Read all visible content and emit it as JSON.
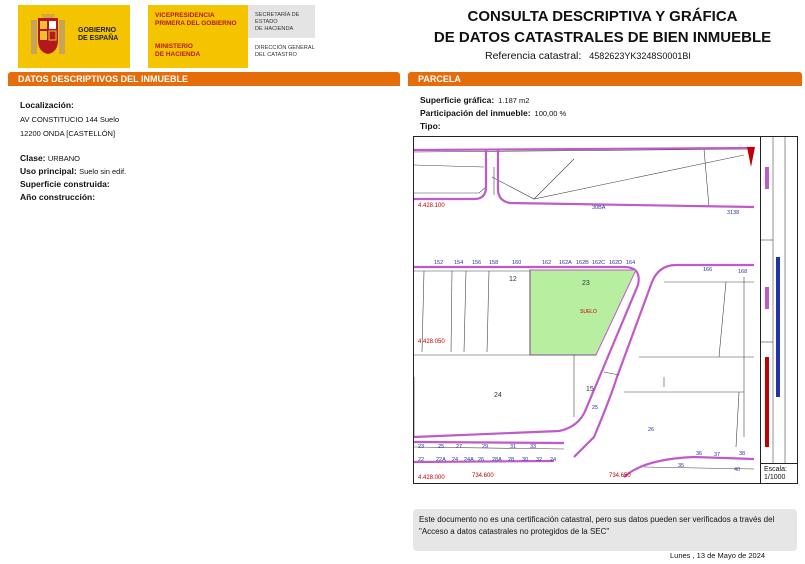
{
  "header": {
    "gobierno": [
      "GOBIERNO",
      "DE ESPAÑA"
    ],
    "vicepresidencia": [
      "VICEPRESIDENCIA",
      "PRIMERA DEL GOBIERNO"
    ],
    "ministerio": [
      "MINISTERIO",
      "DE HACIENDA"
    ],
    "secretaria": [
      "SECRETARÍA DE ESTADO",
      "DE HACIENDA"
    ],
    "direccion": [
      "DIRECCIÓN GENERAL",
      "DEL CATASTRO"
    ],
    "title_line1": "CONSULTA DESCRIPTIVA Y GRÁFICA",
    "title_line2": "DE DATOS CATASTRALES DE BIEN INMUEBLE",
    "ref_label": "Referencia catastral:",
    "ref_value": "4582623YK3248S0001BI"
  },
  "left": {
    "bar": "DATOS DESCRIPTIVOS DEL INMUEBLE",
    "localizacion_label": "Localización:",
    "localizacion_line1": "AV CONSTITUCIO 144 Suelo",
    "localizacion_line2": "12200 ONDA [CASTELLÓN]",
    "clase_label": "Clase:",
    "clase_value": "URBANO",
    "uso_label": "Uso principal:",
    "uso_value": "Suelo sin edif.",
    "superficie_label": "Superficie construida:",
    "anio_label": "Año construcción:"
  },
  "right": {
    "bar": "PARCELA",
    "sup_label": "Superficie gráfica:",
    "sup_value": "1.187 m2",
    "part_label": "Participación del inmueble:",
    "part_value": "100,00 %",
    "tipo_label": "Tipo:"
  },
  "map": {
    "parcel_label": "SUELO",
    "numbers": [
      "12",
      "23",
      "24",
      "15",
      "25",
      "30BA",
      "3138",
      "166",
      "168",
      "26",
      "35",
      "36",
      "37",
      "38",
      "40"
    ],
    "coord_y1": "4.428.100",
    "coord_y2": "4.428.050",
    "coord_y3": "4.428.000",
    "coord_x1": "734.600",
    "coord_x2": "734.650",
    "street_numbers": [
      "152",
      "154",
      "156",
      "158",
      "160",
      "162",
      "162A",
      "162B",
      "162C",
      "162D",
      "164"
    ],
    "bottom_numbers": [
      "23",
      "25",
      "27",
      "29",
      "31",
      "33"
    ],
    "bottom_numbers2": [
      "22",
      "22A",
      "24",
      "24A",
      "26",
      "28A",
      "28",
      "30",
      "32",
      "24"
    ],
    "legend_escala_label": "Escala:",
    "legend_escala_value": "1/1000"
  },
  "note": "Este documento no es una certificación catastral, pero sus datos pueden ser verificados a través del \"Acceso a datos catastrales no protegidos de la SEC\"",
  "date": "Lunes , 13 de Mayo de 2024",
  "colors": {
    "orange": "#e46c0a",
    "parcel_green": "#b8eea0",
    "boundary_purple": "#c05ac8",
    "gov_yellow": "#f5c400"
  }
}
